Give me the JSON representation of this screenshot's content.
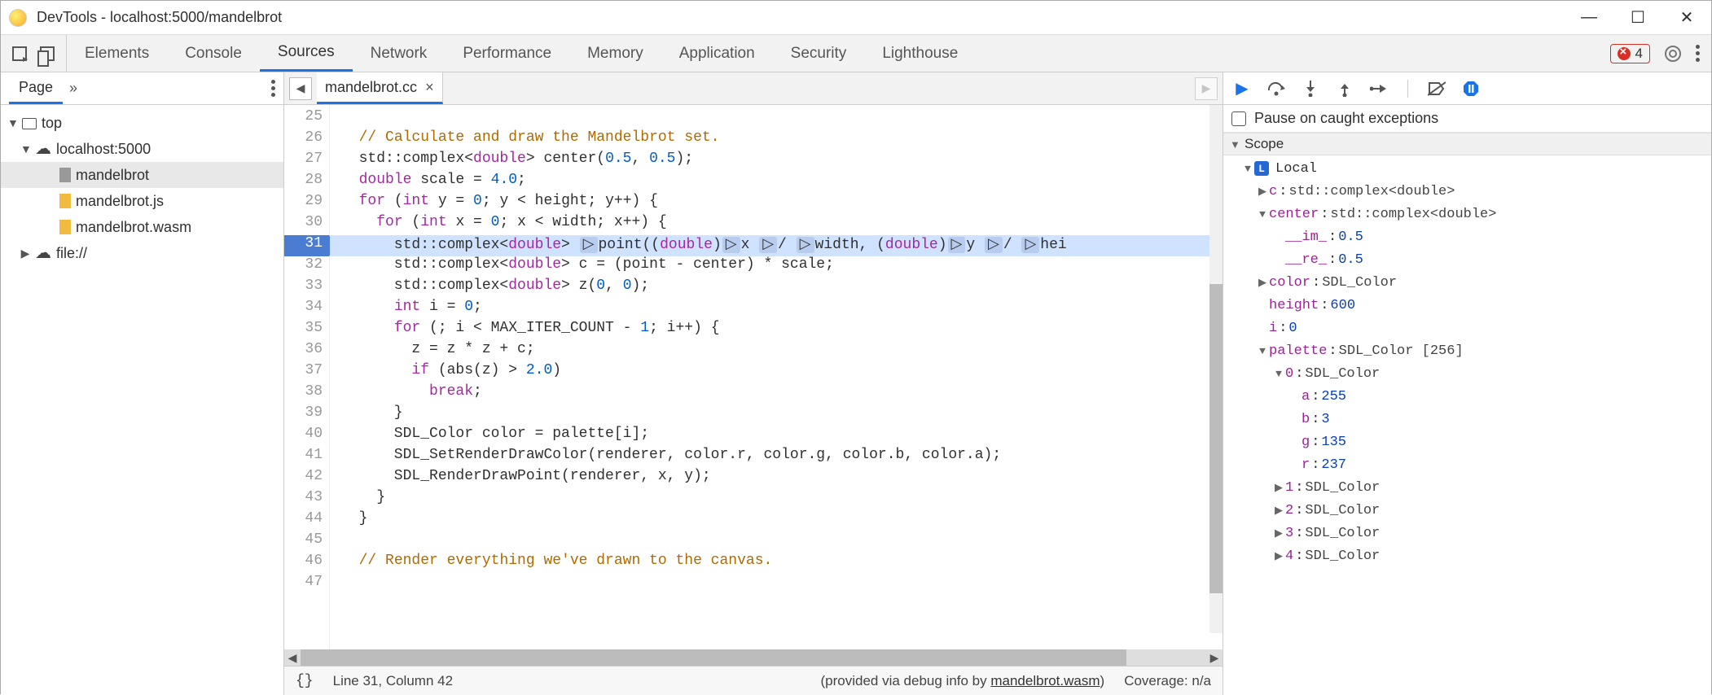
{
  "window": {
    "title": "DevTools - localhost:5000/mandelbrot"
  },
  "panels": {
    "items": [
      "Elements",
      "Console",
      "Sources",
      "Network",
      "Performance",
      "Memory",
      "Application",
      "Security",
      "Lighthouse"
    ],
    "active": "Sources",
    "error_count": "4"
  },
  "navigator": {
    "tab": "Page",
    "tree": {
      "top": "top",
      "domain": "localhost:5000",
      "files": [
        "mandelbrot",
        "mandelbrot.js",
        "mandelbrot.wasm"
      ],
      "file_scheme": "file://"
    }
  },
  "editor": {
    "tab_name": "mandelbrot.cc",
    "first_line": 25,
    "breakpoint_line": 31,
    "lines": [
      "",
      "  // Calculate and draw the Mandelbrot set.",
      "  std::complex<double> center(0.5, 0.5);",
      "  double scale = 4.0;",
      "  for (int y = 0; y < height; y++) {",
      "    for (int x = 0; x < width; x++) {",
      "      std::complex<double> point((double)x / width, (double)y / hei",
      "      std::complex<double> c = (point - center) * scale;",
      "      std::complex<double> z(0, 0);",
      "      int i = 0;",
      "      for (; i < MAX_ITER_COUNT - 1; i++) {",
      "        z = z * z + c;",
      "        if (abs(z) > 2.0)",
      "          break;",
      "      }",
      "      SDL_Color color = palette[i];",
      "      SDL_SetRenderDrawColor(renderer, color.r, color.g, color.b, color.a);",
      "      SDL_RenderDrawPoint(renderer, x, y);",
      "    }",
      "  }",
      "",
      "  // Render everything we've drawn to the canvas.",
      ""
    ],
    "status": {
      "pos": "Line 31, Column 42",
      "debug_info_prefix": "(provided via debug info by ",
      "debug_info_link": "mandelbrot.wasm",
      "debug_info_suffix": ")",
      "coverage": "Coverage: n/a"
    }
  },
  "debugger": {
    "pause_on_caught": "Pause on caught exceptions",
    "scope_header": "Scope",
    "local_label": "Local",
    "vars": {
      "c": {
        "name": "c",
        "type": "std::complex<double>"
      },
      "center": {
        "name": "center",
        "type": "std::complex<double>",
        "im_key": "__im_",
        "im_val": "0.5",
        "re_key": "__re_",
        "re_val": "0.5"
      },
      "color": {
        "name": "color",
        "type": "SDL_Color"
      },
      "height": {
        "name": "height",
        "value": "600"
      },
      "i": {
        "name": "i",
        "value": "0"
      },
      "palette": {
        "name": "palette",
        "type": "SDL_Color [256]",
        "item0": {
          "idx": "0",
          "type": "SDL_Color",
          "a_key": "a",
          "a_val": "255",
          "b_key": "b",
          "b_val": "3",
          "g_key": "g",
          "g_val": "135",
          "r_key": "r",
          "r_val": "237"
        },
        "item1": {
          "idx": "1",
          "type": "SDL_Color"
        },
        "item2": {
          "idx": "2",
          "type": "SDL_Color"
        },
        "item3": {
          "idx": "3",
          "type": "SDL_Color"
        },
        "item4": {
          "idx": "4",
          "type": "SDL_Color"
        }
      }
    }
  }
}
